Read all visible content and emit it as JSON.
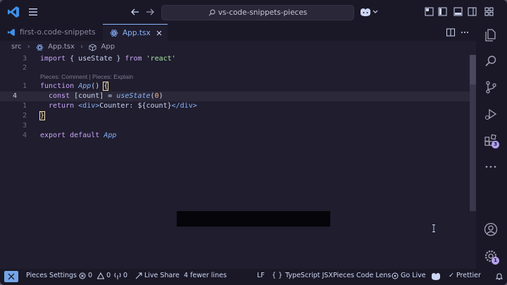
{
  "window": {
    "search_text": "vs-code-snippets-pieces"
  },
  "tabs": [
    {
      "label": "first-o.code-snippets"
    },
    {
      "label": "App.tsx"
    }
  ],
  "breadcrumbs": {
    "folder": "src",
    "file": "App.tsx",
    "symbol": "App"
  },
  "codelens": "Pieces: Comment | Pieces: Explain",
  "gutter": [
    "3",
    "2",
    "1",
    "4",
    "1",
    "2",
    "3",
    "4"
  ],
  "code": {
    "l1": {
      "kw": "import",
      "p1": " { useState } ",
      "kw2": "from",
      "str": " 'react'"
    },
    "l3": {
      "kw": "function",
      "fn": "App",
      "p1": "() ",
      "brace": "{"
    },
    "l4": {
      "kw": "const",
      "p1": " [count] = ",
      "fn": "useState",
      "p2": "(",
      "num": "0",
      "p3": ")"
    },
    "l5": {
      "kw": "return",
      "p1": " ",
      "t1": "<div>",
      "p2": "Counter: ${count}",
      "t2": "</div>"
    },
    "l6": {
      "brace": "}"
    },
    "l8": {
      "kw": "export",
      "kw2": " default ",
      "fn": "App"
    }
  },
  "activity_badges": {
    "extensions": "3",
    "settings": "1"
  },
  "status": {
    "pieces_settings": "Pieces Settings",
    "errors": "0",
    "warnings": "0",
    "ports": "0",
    "live_share": "Live Share",
    "diff": "4 fewer lines",
    "eol": "LF",
    "language": "TypeScript JSX",
    "code_lens": "Pieces Code Lens",
    "go_live": "Go Live",
    "prettier": "Prettier"
  },
  "colors": {
    "accent": "#89b4fa",
    "keyword": "#cba6f7",
    "string": "#a6e3a1",
    "number": "#fab387",
    "background": "#1f1d2e"
  }
}
